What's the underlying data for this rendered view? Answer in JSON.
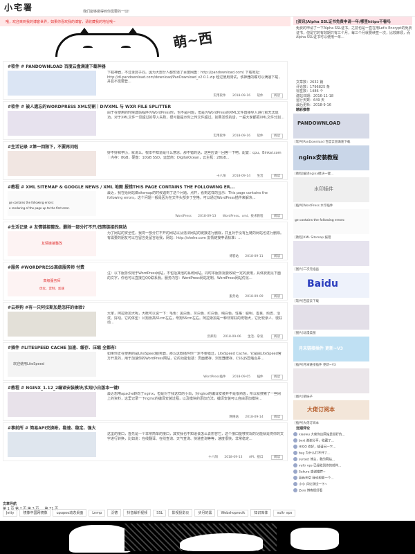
{
  "header": {
    "logo": "小宅署",
    "tagline": "我们能够做得到你需要的一切!"
  },
  "notice": "哦，欢迎来到我的博客世界，如果你喜欢我的博客，请收藏我的地址哦~",
  "banner": {
    "moe_text": "萌~西"
  },
  "posts": [
    {
      "title": "#软件 # PANDOWNLOAD 百度云盘满速下载神器",
      "excerpt": "下载神器，不过录屏子同。因为大部分人都知道了百度网盘：http://pandownload.com/ 下载地址：http://dl.pandownload.com/download/PanDownload_v2.0.1.zip 经过使用测试，该神器的确可以满速下载，并且不需要登...",
      "date": "2018-09-16",
      "category": "软件",
      "author": "实用软件",
      "more": "阅读"
    },
    {
      "title": "#软件 # 被人遗忘的WORDPRESS XML切割｜DIVXML 与 WXR FILE SPLITTER",
      "excerpt": "由于在使用的时候建站程序为WordPress时，也不是问题，但是为WordPress的XML文件直接导入进行就无法成功。对于XML文件一旦超过的导入失败，很可能提示你上传文件超过。如果发现的话，一般大家都把XML文件分割...",
      "date": "2018-09-16",
      "category": "软件",
      "author": "实用软件",
      "more": "阅读"
    },
    {
      "title": "#生活记录 #第一回限下，不要再问啦",
      "excerpt": "好不好和学历，就说么，根本不知道是什么意思，那不错的话，这些应该一回答一下吧。配置：cpu、Binkai.com｜内存：8GB，硬盘：10GB SSD，运营商：DigitalOcean，云主机：28GB...",
      "date": "2018-09-14",
      "category": "生活",
      "author": "十八阳",
      "more": "阅读"
    },
    {
      "title": "#教程 # XML SITEMAP & GOOGLE NEWS / XML 地图 报错THIS PAGE CONTAINS THE FOLLOWING ER...",
      "excerpt": "最近，我在给网站做sitemap的时候遇到了这个问题，点开，看到这样的显示：This page contains the following errors，这个问题一般是因为在文件头部多了空格，可以通过WordPress插件来解决...",
      "date": "2018-09-13",
      "category": "WordPress、xml、技术教程",
      "author": "WordPress",
      "more": "阅读",
      "thumb_line1": "ge contains the following errors:",
      "thumb_line2": "e rendering of the page up to the first error."
    },
    {
      "title": "#生活记录 # 友情链接整改，删除一部分打不开/违禁链接的网站",
      "excerpt": "为了网站的安全性，我将一部分打不开的网站以及违法网站的链接进行删除，并且对于没有互链的网站也进行删除。有需要的朋友可以在留言处留言给我，网站：http://shehe.com 友情链接申请标准：...",
      "date": "2018-09-11",
      "category": "",
      "author": "博客站",
      "more": "阅读",
      "thumb_text": "友情链接整改"
    },
    {
      "title": "#服务 #WORDPRESS高级服务师 付费",
      "excerpt": "注：以下服务仅限于WordPress网站，不包括其他的系统网站。同时本服务需要收取一定的费用，具体费用见下面的文字，你也可以直接在QQ联系我。服务内容：WordPress网站定制、WordPress网站优化...",
      "date": "2018-09-09",
      "category": "",
      "author": "服务站",
      "more": "阅读",
      "thumb_text": "高级服务师",
      "thumb_sub": "优化、定制、加速"
    },
    {
      "title": "#云养狗 #有一只阿拉斯加是怎样的体验?",
      "excerpt": "大家，阿拉斯加犬呢，大概可以说一下：毛色：黑白色、灰白色、红白色、纯白色。性格：聪明、善良、顽皮、活泼、好动。它的体型：公狗身高61cm左右，母狗56cm左右。阿拉斯加是一种非常好的宠物犬，它比较亲人、很好动...",
      "date": "2018-09-06",
      "category": "生活、杂谈",
      "author": "云养狗",
      "more": "阅读"
    },
    {
      "title": "#插件 #LITESPEED CACHE 加速、缓存、压缩 全都有!",
      "excerpt": "如果你正在使用的是LiteSpeed服务器，那么这款插件你一定不要错过，LiteSpeed Cache，它是由LiteSpeed官方开发的，用于加速你的WordPress网站，它的功能包括：页面缓存、浏览器缓存、CSS/JS压缩合并...",
      "date": "2018-09-05",
      "category": "插件",
      "author": "WordPress插件",
      "more": "阅读",
      "thumb_text": "欢迎使用LiteSpeed"
    },
    {
      "title": "#教程 # NGINX_1.12_2编译安装模块/实现小白版本一键!",
      "excerpt": "最近想用apache转向了nginx，但是对于我这样的小白，对nginx的编译安装并不是很熟悉，所以就搜索了一些网上的资料，这里记录一下nginx的编译安装过程，以及模块的添加方法，编译安装可以自由添加模块...",
      "date": "2018-09-14",
      "category": "",
      "author": "网络站",
      "more": "阅读"
    },
    {
      "title": "#事前所 # 简易API交换帐，稳速、稳定、强大",
      "excerpt": "这里的接口，首先是一个非常简单的接口，其实我也不知道该怎么去形容它，这个接口能够实现的功能就是将你的文字进行转换，比如说：在线翻译、在线查询、天气查询、快递查询等等，速度很快，非常稳定...",
      "date": "2018-09-13",
      "category": "API、接口",
      "author": "十八阳",
      "more": "阅读"
    }
  ],
  "sidebar": {
    "announcement_title": "[资讯]Alpha SSL证书免费申请一年/哪里https不看吗",
    "announcement_text": "免费的申请了一下Alpha SSL证书，之前也是一直在用Let's Encrypt的免费证书，但是它的有效期只有三个月，每三个月就要续签一次，比较麻烦，而Alpha SSL证书可以使用一年...",
    "stats": [
      "文章数：2632 篇",
      "评论数：1796825 条",
      "标签数：1486 个",
      "建站日期：2016-11-18",
      "运行天数：649 天",
      "最后更新：2018-9-16"
    ],
    "recommend_title": "精彩推荐",
    "widgets": [
      {
        "caption": "[软件]PanDownload 百度云盘满速下载",
        "img_text": "PANDOWNLOAD"
      },
      {
        "caption": "[教程]编译nginx模块一键...",
        "img_text": "nginx安装教程"
      },
      {
        "caption": "[插件]WordPress 水印插件",
        "img_text": "水印插件"
      },
      {
        "caption": "[教程]XML Sitemap 报错",
        "img_text": "ge contains the following errors:"
      },
      {
        "caption": "[图片]二次元插画",
        "img_text": ""
      },
      {
        "caption": "[软件]百度云下载",
        "img_text": "Baidu"
      },
      {
        "caption": "[图片]动漫美图",
        "img_text": ""
      },
      {
        "caption": "[插件]月末链接插件 更新~V3",
        "img_text": "月末链接插件 更新~V3"
      },
      {
        "caption": "[图片]萌妹子",
        "img_text": ""
      },
      {
        "caption": "[插件]大佬订阅本",
        "img_text": "大佬订阅本"
      }
    ],
    "recent_title": "近期评论",
    "recent": [
      "xiaowu 大佬你这网站是挺好的...",
      "bert 谢谢分享，收藏了...",
      "HIGO 你好，想请问一下...",
      "bay 为什么打不开了...",
      "sunset 博主，我的网站...",
      "vultr vps 已经收到你的邮件...",
      "Sakura 感谢推荐~",
      "蓝色天空 我也想要一个...",
      "小小 评论测试一下~",
      "Zero 博客很好看"
    ]
  },
  "pagination": {
    "label": "文章导航",
    "text": "第 1 页 第 2 页 第 3 页 … 第 71 页"
  },
  "tags": [
    "Jetty",
    "镜像中国网镜像",
    "upupoo动态桌面",
    "Lnmp",
    "沃德",
    "抖音解析视频",
    "SSL",
    "影视投影仪",
    "步月的黑",
    "Webshoprocik",
    "知识库体",
    "vultr vps"
  ]
}
